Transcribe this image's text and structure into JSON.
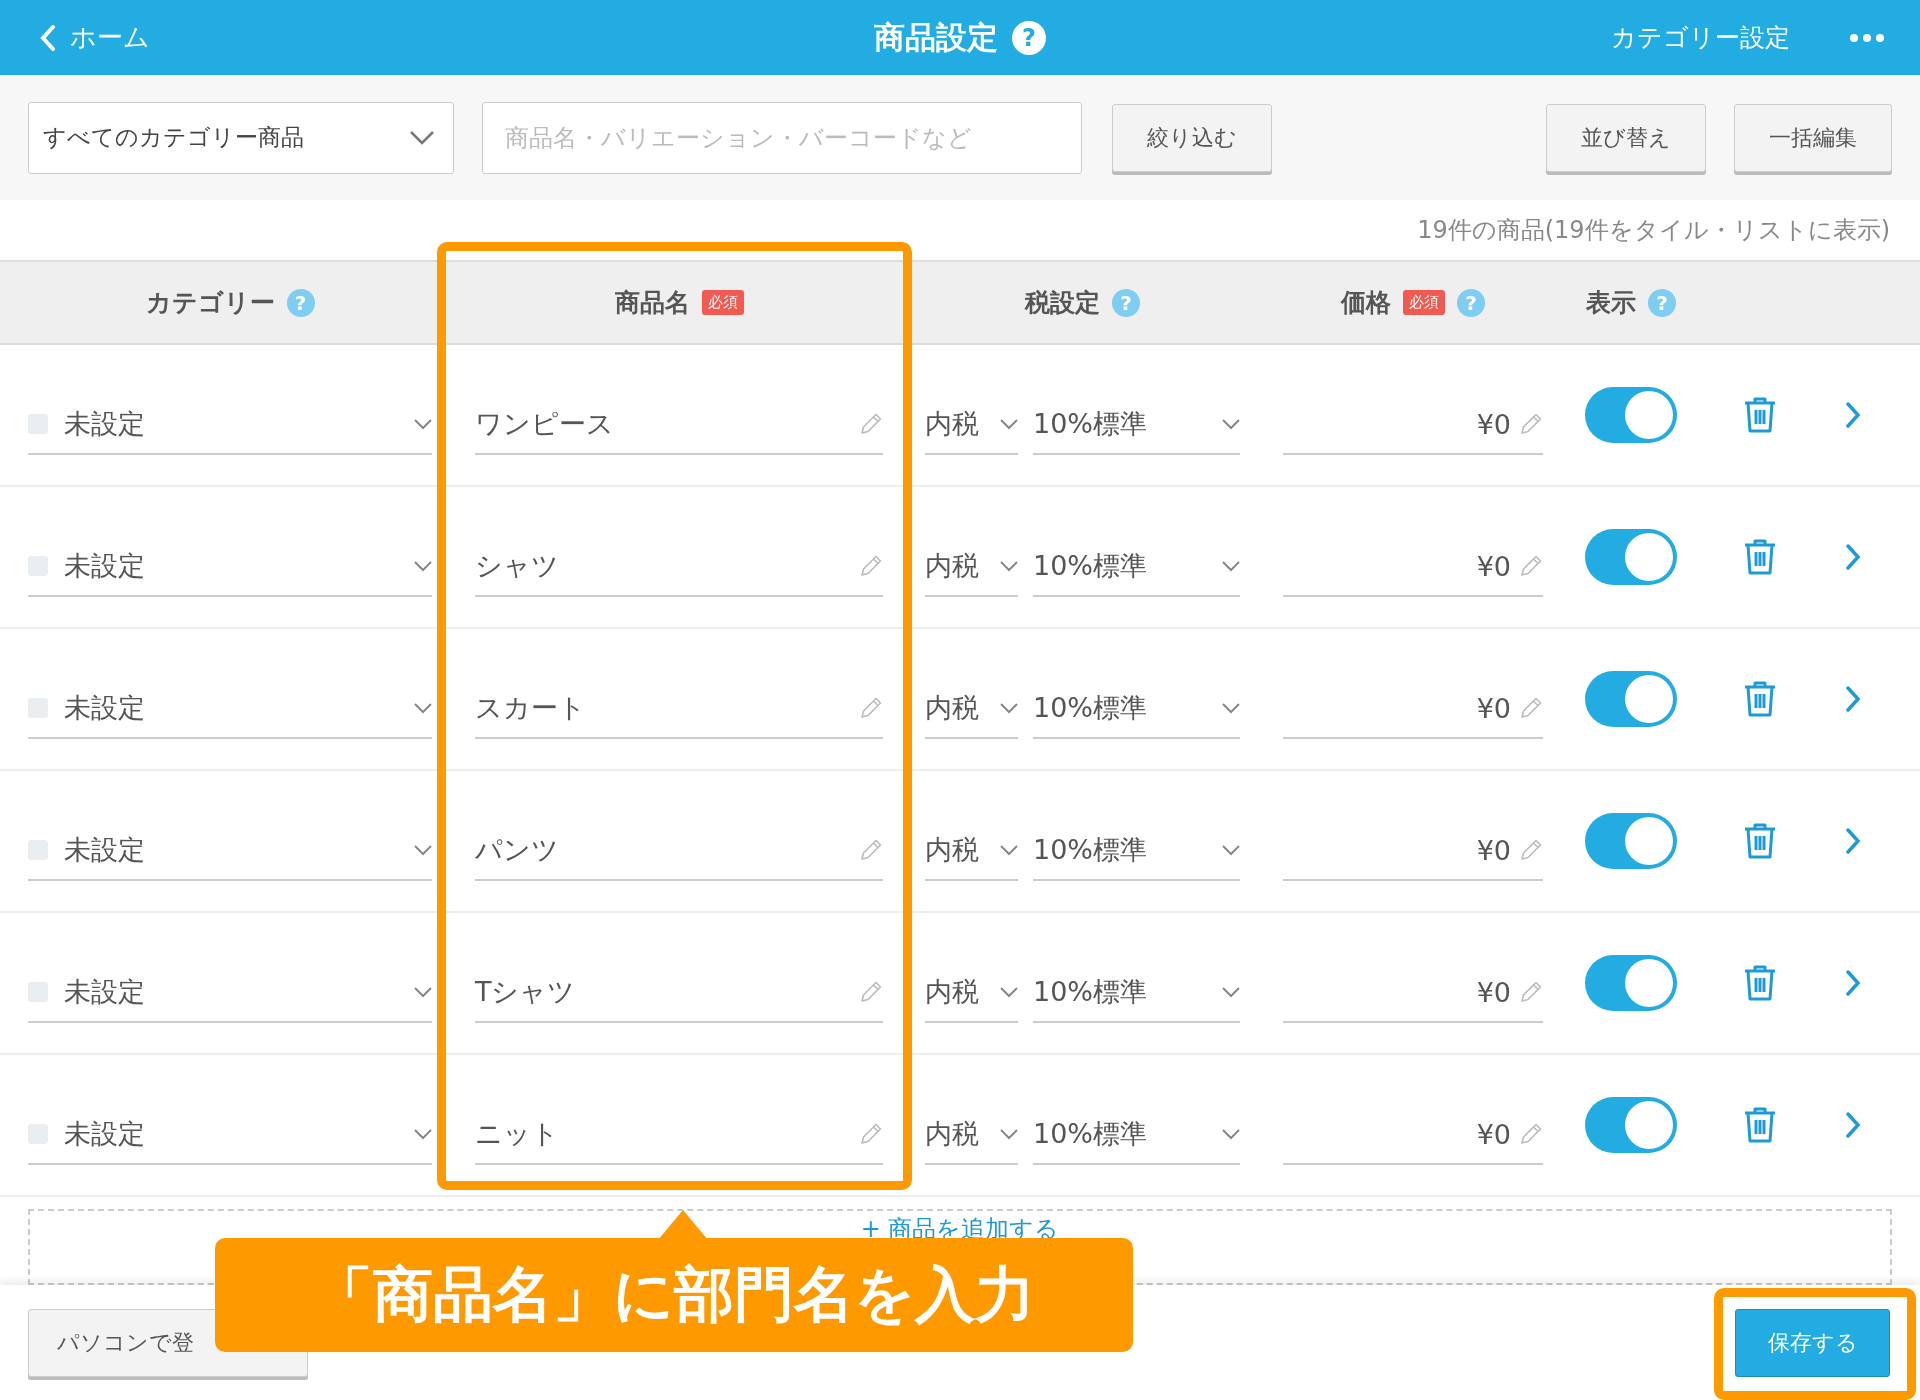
{
  "header": {
    "back": "ホーム",
    "title": "商品設定",
    "help": "?",
    "right_link": "カテゴリー設定"
  },
  "toolbar": {
    "category_select": "すべてのカテゴリー商品",
    "search": {
      "placeholder": "商品名・バリエーション・バーコードなど"
    },
    "filter_button": "絞り込む",
    "sort_button": "並び替え",
    "bulk_edit_button": "一括編集"
  },
  "count": "19件の商品(19件をタイル・リストに表示)",
  "columns": [
    {
      "label": "カテゴリー",
      "help": "?"
    },
    {
      "label": "商品名",
      "badge": "必須"
    },
    {
      "label": "税設定",
      "help": "?"
    },
    {
      "label": "価格",
      "badge": "必須",
      "help": "?"
    },
    {
      "label": "表示",
      "help": "?"
    }
  ],
  "rows": [
    {
      "checked": false,
      "category": "未設定",
      "name": "ワンピース",
      "tax_type": "内税",
      "tax_rate": "10%標準",
      "price": "¥0",
      "visible": true
    },
    {
      "checked": false,
      "category": "未設定",
      "name": "シャツ",
      "tax_type": "内税",
      "tax_rate": "10%標準",
      "price": "¥0",
      "visible": true
    },
    {
      "checked": false,
      "category": "未設定",
      "name": "スカート",
      "tax_type": "内税",
      "tax_rate": "10%標準",
      "price": "¥0",
      "visible": true
    },
    {
      "checked": false,
      "category": "未設定",
      "name": "パンツ",
      "tax_type": "内税",
      "tax_rate": "10%標準",
      "price": "¥0",
      "visible": true
    },
    {
      "checked": false,
      "category": "未設定",
      "name": "Tシャツ",
      "tax_type": "内税",
      "tax_rate": "10%標準",
      "price": "¥0",
      "visible": true
    },
    {
      "checked": false,
      "category": "未設定",
      "name": "ニット",
      "tax_type": "内税",
      "tax_rate": "10%標準",
      "price": "¥0",
      "visible": true
    }
  ],
  "add_product": "+ 商品を追加する",
  "footer": {
    "pc_button": "パソコンで登",
    "save_button": "保存する"
  },
  "annotation": "「商品名」に部門名を入力"
}
